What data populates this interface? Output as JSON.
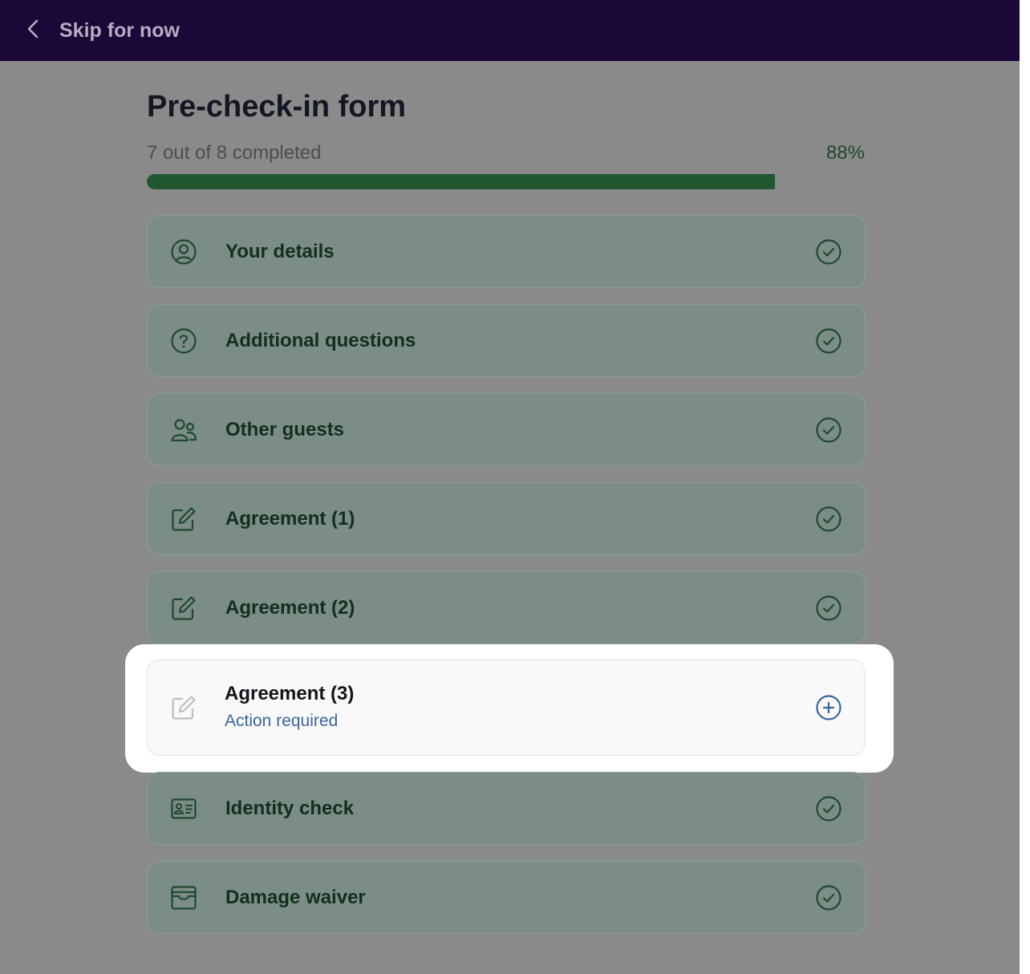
{
  "header": {
    "back_label": "Skip for now"
  },
  "form": {
    "title": "Pre-check-in form",
    "progress_text": "7 out of 8 completed",
    "progress_percent_label": "88%",
    "progress_fraction": 0.875
  },
  "steps": [
    {
      "label": "Your details",
      "icon": "user-circle-icon",
      "status": "completed"
    },
    {
      "label": "Additional questions",
      "icon": "question-circle-icon",
      "status": "completed"
    },
    {
      "label": "Other guests",
      "icon": "users-icon",
      "status": "completed"
    },
    {
      "label": "Agreement (1)",
      "icon": "pen-square-icon",
      "status": "completed"
    },
    {
      "label": "Agreement (2)",
      "icon": "pen-square-icon",
      "status": "completed"
    },
    {
      "label": "Agreement (3)",
      "sublabel": "Action required",
      "icon": "pen-square-icon",
      "status": "pending"
    },
    {
      "label": "Identity check",
      "icon": "id-card-icon",
      "status": "completed"
    },
    {
      "label": "Damage waiver",
      "icon": "wallet-icon",
      "status": "completed"
    }
  ],
  "colors": {
    "header_bg": "#1b0838",
    "progress_fill": "#21572f",
    "completed_text": "#122f1d",
    "action_required": "#3a64a0"
  }
}
